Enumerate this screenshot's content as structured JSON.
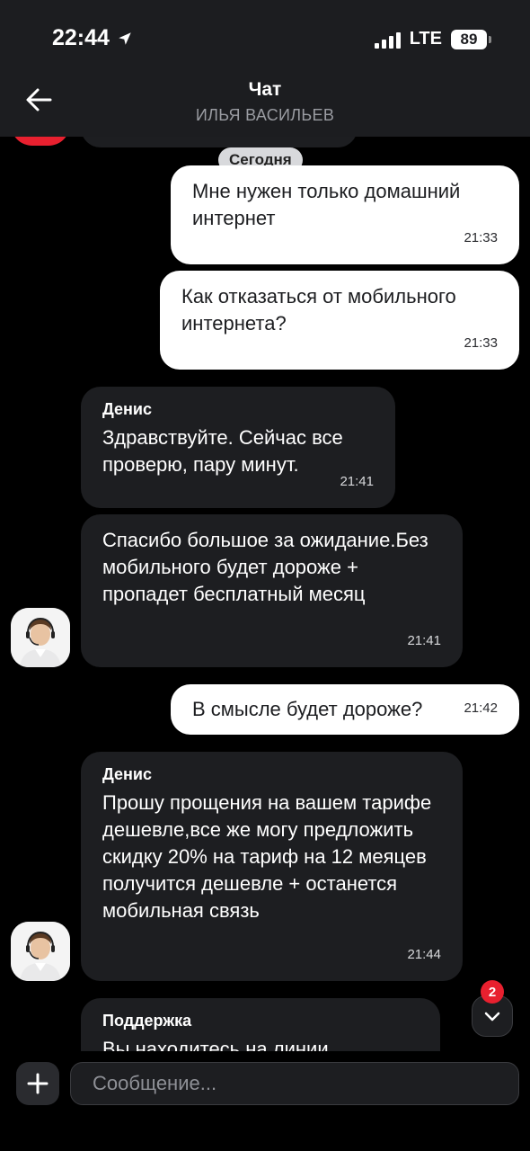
{
  "status_bar": {
    "time": "22:44",
    "network": "LTE",
    "battery": "89"
  },
  "header": {
    "title": "Чат",
    "subtitle": "ИЛЬЯ ВАСИЛЬЕВ"
  },
  "date_divider": "Сегодня",
  "messages": [
    {
      "direction": "out",
      "text": "Мне нужен только домашний интернет",
      "time": "21:33"
    },
    {
      "direction": "out",
      "text": "Как отказаться от мобильного интернета?",
      "time": "21:33"
    },
    {
      "direction": "in",
      "sender": "Денис",
      "text": "Здравствуйте. Сейчас все проверю, пару минут.",
      "time": "21:41"
    },
    {
      "direction": "in",
      "text": "Спасибо большое за ожидание.Без мобильного будет дороже + пропадет бесплатный месяц",
      "time": "21:41"
    },
    {
      "direction": "out",
      "text": "В смысле будет дороже?",
      "time": "21:42"
    },
    {
      "direction": "in",
      "sender": "Денис",
      "text": "Прошу прощения на вашем тарифе дешевле,все же могу предложить скидку 20% на тариф на 12 меяцев получится дешевле + останется мобильная связь",
      "time": "21:44"
    },
    {
      "direction": "in",
      "sender": "Поддержка",
      "text": "Вы находитесь на линии",
      "time": ""
    }
  ],
  "unread_badge": "2",
  "composer": {
    "placeholder": "Сообщение..."
  },
  "colors": {
    "accent": "#e8202f",
    "background": "#000000",
    "incoming_bubble": "#1d1e21",
    "outgoing_bubble": "#ffffff"
  }
}
